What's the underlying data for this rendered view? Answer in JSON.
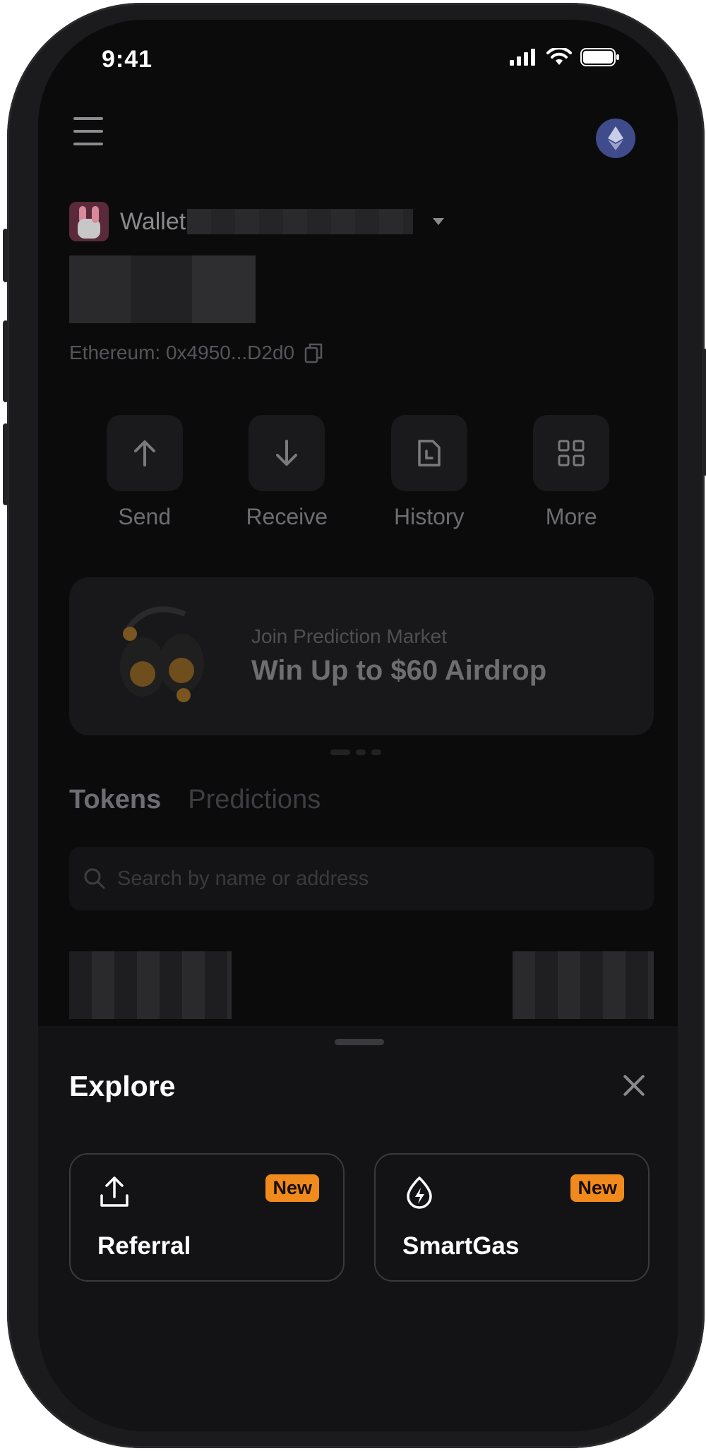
{
  "status_bar": {
    "time": "9:41"
  },
  "wallet": {
    "name": "Wallet",
    "address": "Ethereum: 0x4950...D2d0"
  },
  "actions": [
    {
      "label": "Send",
      "icon": "arrow-up-icon"
    },
    {
      "label": "Receive",
      "icon": "arrow-down-icon"
    },
    {
      "label": "History",
      "icon": "document-icon"
    },
    {
      "label": "More",
      "icon": "grid-icon"
    }
  ],
  "promo": {
    "subtitle": "Join Prediction Market",
    "title": "Win Up to $60 Airdrop"
  },
  "tabs": [
    {
      "label": "Tokens",
      "active": true
    },
    {
      "label": "Predictions",
      "active": false
    }
  ],
  "search": {
    "placeholder": "Search by name or address"
  },
  "explore_sheet": {
    "title": "Explore",
    "cards": [
      {
        "label": "Referral",
        "badge": "New",
        "icon": "upload-icon"
      },
      {
        "label": "SmartGas",
        "badge": "New",
        "icon": "gas-bolt-icon"
      }
    ]
  },
  "colors": {
    "badge": "#f08a1c",
    "eth_icon_bg": "#3f4b8a",
    "sheet_bg": "#131315"
  }
}
